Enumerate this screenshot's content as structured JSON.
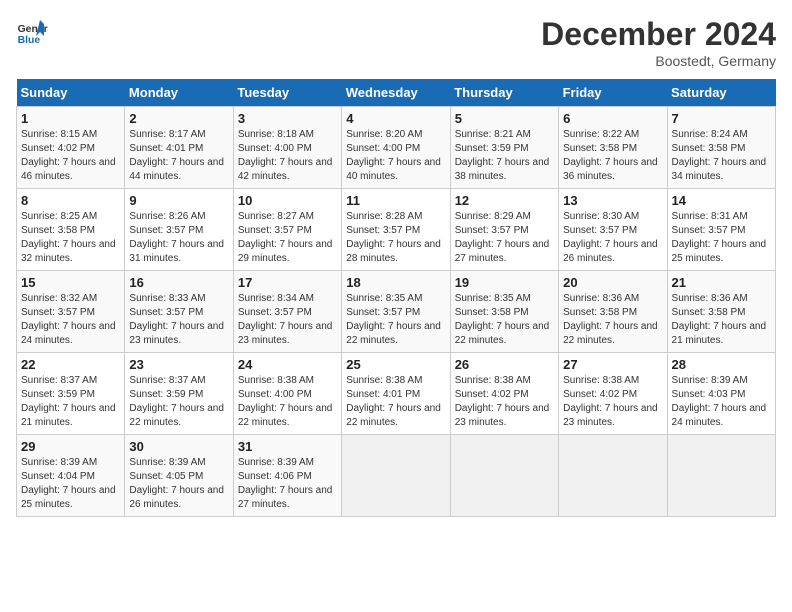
{
  "header": {
    "logo_line1": "General",
    "logo_line2": "Blue",
    "month_title": "December 2024",
    "location": "Boostedt, Germany"
  },
  "days_of_week": [
    "Sunday",
    "Monday",
    "Tuesday",
    "Wednesday",
    "Thursday",
    "Friday",
    "Saturday"
  ],
  "weeks": [
    [
      {
        "day": "1",
        "sunrise": "Sunrise: 8:15 AM",
        "sunset": "Sunset: 4:02 PM",
        "daylight": "Daylight: 7 hours and 46 minutes."
      },
      {
        "day": "2",
        "sunrise": "Sunrise: 8:17 AM",
        "sunset": "Sunset: 4:01 PM",
        "daylight": "Daylight: 7 hours and 44 minutes."
      },
      {
        "day": "3",
        "sunrise": "Sunrise: 8:18 AM",
        "sunset": "Sunset: 4:00 PM",
        "daylight": "Daylight: 7 hours and 42 minutes."
      },
      {
        "day": "4",
        "sunrise": "Sunrise: 8:20 AM",
        "sunset": "Sunset: 4:00 PM",
        "daylight": "Daylight: 7 hours and 40 minutes."
      },
      {
        "day": "5",
        "sunrise": "Sunrise: 8:21 AM",
        "sunset": "Sunset: 3:59 PM",
        "daylight": "Daylight: 7 hours and 38 minutes."
      },
      {
        "day": "6",
        "sunrise": "Sunrise: 8:22 AM",
        "sunset": "Sunset: 3:58 PM",
        "daylight": "Daylight: 7 hours and 36 minutes."
      },
      {
        "day": "7",
        "sunrise": "Sunrise: 8:24 AM",
        "sunset": "Sunset: 3:58 PM",
        "daylight": "Daylight: 7 hours and 34 minutes."
      }
    ],
    [
      {
        "day": "8",
        "sunrise": "Sunrise: 8:25 AM",
        "sunset": "Sunset: 3:58 PM",
        "daylight": "Daylight: 7 hours and 32 minutes."
      },
      {
        "day": "9",
        "sunrise": "Sunrise: 8:26 AM",
        "sunset": "Sunset: 3:57 PM",
        "daylight": "Daylight: 7 hours and 31 minutes."
      },
      {
        "day": "10",
        "sunrise": "Sunrise: 8:27 AM",
        "sunset": "Sunset: 3:57 PM",
        "daylight": "Daylight: 7 hours and 29 minutes."
      },
      {
        "day": "11",
        "sunrise": "Sunrise: 8:28 AM",
        "sunset": "Sunset: 3:57 PM",
        "daylight": "Daylight: 7 hours and 28 minutes."
      },
      {
        "day": "12",
        "sunrise": "Sunrise: 8:29 AM",
        "sunset": "Sunset: 3:57 PM",
        "daylight": "Daylight: 7 hours and 27 minutes."
      },
      {
        "day": "13",
        "sunrise": "Sunrise: 8:30 AM",
        "sunset": "Sunset: 3:57 PM",
        "daylight": "Daylight: 7 hours and 26 minutes."
      },
      {
        "day": "14",
        "sunrise": "Sunrise: 8:31 AM",
        "sunset": "Sunset: 3:57 PM",
        "daylight": "Daylight: 7 hours and 25 minutes."
      }
    ],
    [
      {
        "day": "15",
        "sunrise": "Sunrise: 8:32 AM",
        "sunset": "Sunset: 3:57 PM",
        "daylight": "Daylight: 7 hours and 24 minutes."
      },
      {
        "day": "16",
        "sunrise": "Sunrise: 8:33 AM",
        "sunset": "Sunset: 3:57 PM",
        "daylight": "Daylight: 7 hours and 23 minutes."
      },
      {
        "day": "17",
        "sunrise": "Sunrise: 8:34 AM",
        "sunset": "Sunset: 3:57 PM",
        "daylight": "Daylight: 7 hours and 23 minutes."
      },
      {
        "day": "18",
        "sunrise": "Sunrise: 8:35 AM",
        "sunset": "Sunset: 3:57 PM",
        "daylight": "Daylight: 7 hours and 22 minutes."
      },
      {
        "day": "19",
        "sunrise": "Sunrise: 8:35 AM",
        "sunset": "Sunset: 3:58 PM",
        "daylight": "Daylight: 7 hours and 22 minutes."
      },
      {
        "day": "20",
        "sunrise": "Sunrise: 8:36 AM",
        "sunset": "Sunset: 3:58 PM",
        "daylight": "Daylight: 7 hours and 22 minutes."
      },
      {
        "day": "21",
        "sunrise": "Sunrise: 8:36 AM",
        "sunset": "Sunset: 3:58 PM",
        "daylight": "Daylight: 7 hours and 21 minutes."
      }
    ],
    [
      {
        "day": "22",
        "sunrise": "Sunrise: 8:37 AM",
        "sunset": "Sunset: 3:59 PM",
        "daylight": "Daylight: 7 hours and 21 minutes."
      },
      {
        "day": "23",
        "sunrise": "Sunrise: 8:37 AM",
        "sunset": "Sunset: 3:59 PM",
        "daylight": "Daylight: 7 hours and 22 minutes."
      },
      {
        "day": "24",
        "sunrise": "Sunrise: 8:38 AM",
        "sunset": "Sunset: 4:00 PM",
        "daylight": "Daylight: 7 hours and 22 minutes."
      },
      {
        "day": "25",
        "sunrise": "Sunrise: 8:38 AM",
        "sunset": "Sunset: 4:01 PM",
        "daylight": "Daylight: 7 hours and 22 minutes."
      },
      {
        "day": "26",
        "sunrise": "Sunrise: 8:38 AM",
        "sunset": "Sunset: 4:02 PM",
        "daylight": "Daylight: 7 hours and 23 minutes."
      },
      {
        "day": "27",
        "sunrise": "Sunrise: 8:38 AM",
        "sunset": "Sunset: 4:02 PM",
        "daylight": "Daylight: 7 hours and 23 minutes."
      },
      {
        "day": "28",
        "sunrise": "Sunrise: 8:39 AM",
        "sunset": "Sunset: 4:03 PM",
        "daylight": "Daylight: 7 hours and 24 minutes."
      }
    ],
    [
      {
        "day": "29",
        "sunrise": "Sunrise: 8:39 AM",
        "sunset": "Sunset: 4:04 PM",
        "daylight": "Daylight: 7 hours and 25 minutes."
      },
      {
        "day": "30",
        "sunrise": "Sunrise: 8:39 AM",
        "sunset": "Sunset: 4:05 PM",
        "daylight": "Daylight: 7 hours and 26 minutes."
      },
      {
        "day": "31",
        "sunrise": "Sunrise: 8:39 AM",
        "sunset": "Sunset: 4:06 PM",
        "daylight": "Daylight: 7 hours and 27 minutes."
      },
      null,
      null,
      null,
      null
    ]
  ]
}
